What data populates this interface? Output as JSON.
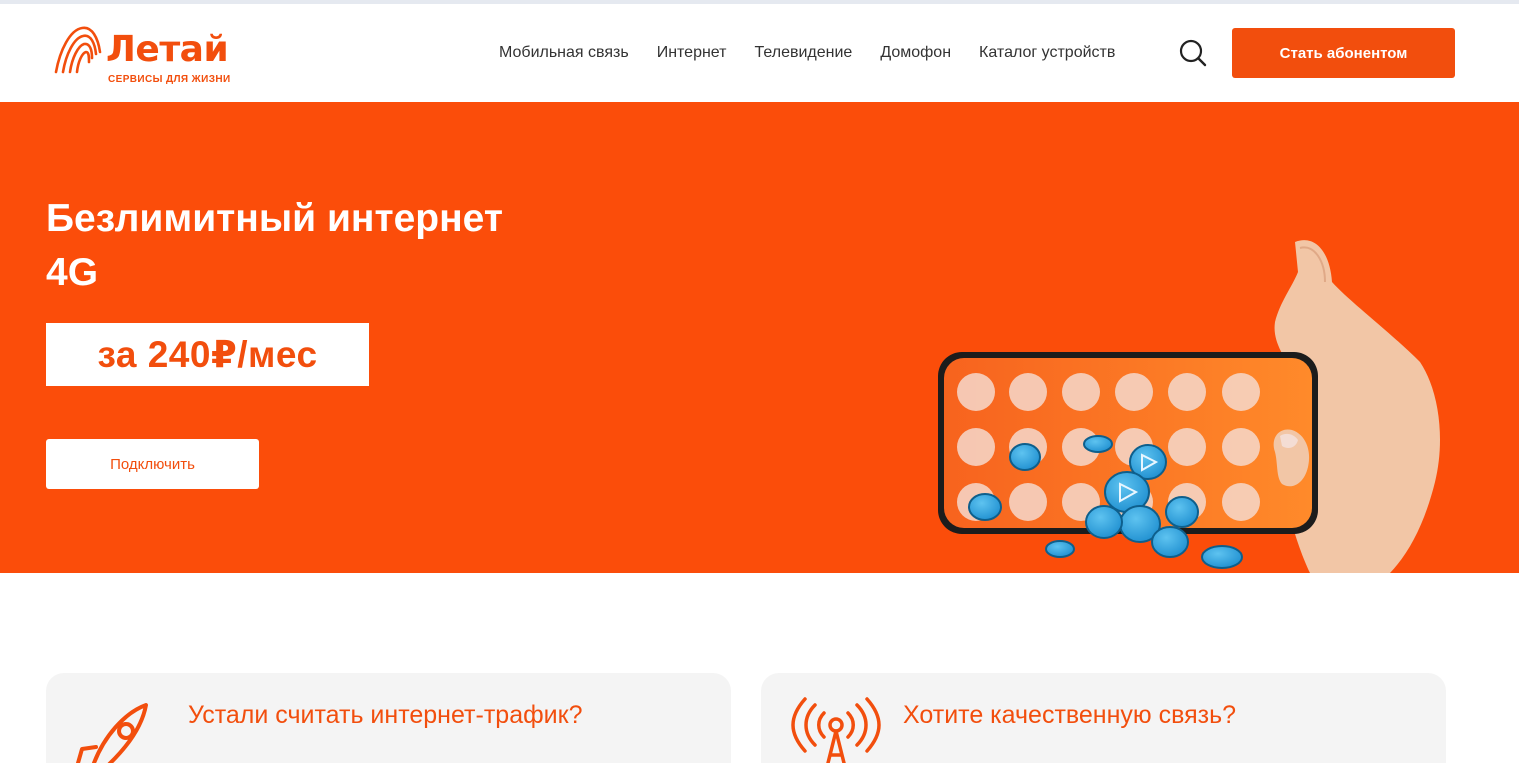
{
  "brand": {
    "name": "Летай",
    "tagline": "СЕРВИСЫ ДЛЯ ЖИЗНИ",
    "accent_color": "#f24e0d",
    "hero_color": "#fb4d0a"
  },
  "nav": {
    "items": [
      {
        "label": "Мобильная связь"
      },
      {
        "label": "Интернет"
      },
      {
        "label": "Телевидение"
      },
      {
        "label": "Домофон"
      },
      {
        "label": "Каталог устройств"
      }
    ],
    "search_icon": "search-icon",
    "cta_label": "Стать абонентом"
  },
  "hero": {
    "title_line1": "Безлимитный интернет",
    "title_line2": "4G",
    "price": "за 240₽/мес",
    "button_label": "Подключить"
  },
  "cards": [
    {
      "title": "Устали считать интернет-трафик?",
      "icon": "rocket-icon"
    },
    {
      "title": "Хотите качественную связь?",
      "icon": "antenna-icon"
    }
  ]
}
